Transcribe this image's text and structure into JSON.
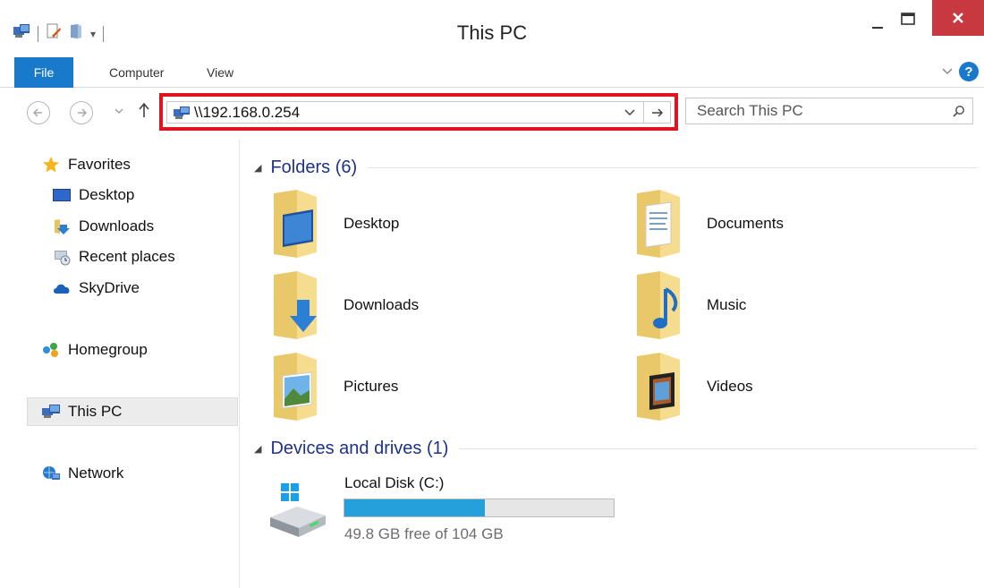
{
  "window": {
    "title": "This PC",
    "close_glyph": "✕",
    "minimize_glyph": "—"
  },
  "ribbon": {
    "tabs": [
      {
        "label": "File"
      },
      {
        "label": "Computer"
      },
      {
        "label": "View"
      }
    ],
    "help_glyph": "?"
  },
  "navigation": {
    "address_value": "\\\\192.168.0.254",
    "search_placeholder": "Search This PC"
  },
  "sidebar": {
    "items": [
      {
        "label": "Favorites",
        "icon": "star-icon"
      },
      {
        "label": "Desktop",
        "icon": "desktop-icon"
      },
      {
        "label": "Downloads",
        "icon": "downloads-icon"
      },
      {
        "label": "Recent places",
        "icon": "recent-places-icon"
      },
      {
        "label": "SkyDrive",
        "icon": "skydrive-icon"
      },
      {
        "label": "Homegroup",
        "icon": "homegroup-icon"
      },
      {
        "label": "This PC",
        "icon": "this-pc-icon",
        "selected": true
      },
      {
        "label": "Network",
        "icon": "network-icon"
      }
    ]
  },
  "main": {
    "folders_header": "Folders (6)",
    "folders": [
      {
        "label": "Desktop",
        "icon": "desktop-folder-icon"
      },
      {
        "label": "Documents",
        "icon": "documents-folder-icon"
      },
      {
        "label": "Downloads",
        "icon": "downloads-folder-icon"
      },
      {
        "label": "Music",
        "icon": "music-folder-icon"
      },
      {
        "label": "Pictures",
        "icon": "pictures-folder-icon"
      },
      {
        "label": "Videos",
        "icon": "videos-folder-icon"
      }
    ],
    "devices_header": "Devices and drives (1)",
    "drive": {
      "label": "Local Disk (C:)",
      "free_text": "49.8 GB free of 104 GB",
      "used_fraction": 0.52,
      "bar_color": "#26a0da"
    }
  },
  "colors": {
    "accent": "#1979ca",
    "highlight_border": "#e0141e",
    "close_button": "#c7383f",
    "group_header": "#1e3287"
  }
}
